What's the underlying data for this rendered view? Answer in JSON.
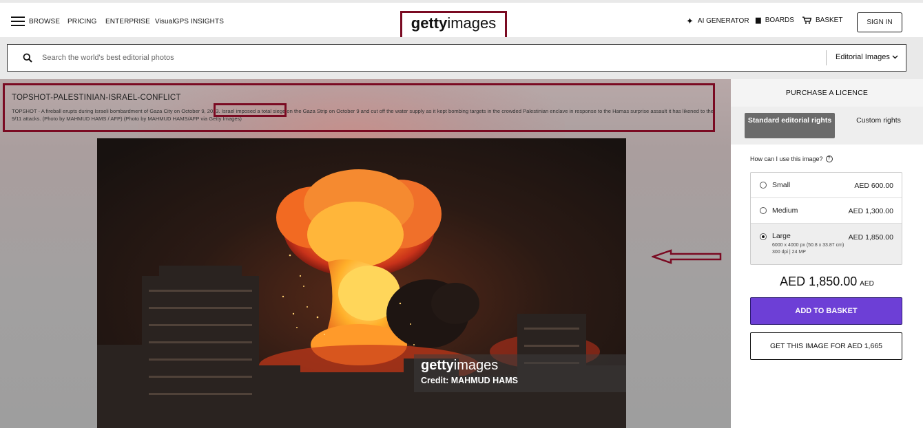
{
  "nav": {
    "browse": "BROWSE",
    "pricing": "PRICING",
    "enterprise": "ENTERPRISE",
    "insights": "VisualGPS INSIGHTS",
    "logo_bold": "getty",
    "logo_light": "images",
    "ai_generator": "AI GENERATOR",
    "boards": "BOARDS",
    "basket": "BASKET",
    "sign_in": "SIGN IN"
  },
  "search": {
    "placeholder": "Search the world's best editorial photos",
    "category": "Editorial Images"
  },
  "caption": {
    "title": "TOPSHOT-PALESTINIAN-ISRAEL-CONFLICT",
    "text": "TOPSHOT - A fireball erupts during Israeli bombardment of Gaza City on October 9, 2023. Israel imposed a total siege on the Gaza Strip on October 9 and cut off the water supply as it kept bombing targets in the crowded Palestinian enclave in response to the Hamas surprise assault it has likened to the 9/11 attacks. (Photo by MAHMUD HAMS / AFP) (Photo by MAHMUD HAMS/AFP via Getty Images)"
  },
  "watermark": {
    "logo_bold": "getty",
    "logo_light": "images",
    "credit": "Credit: MAHMUD HAMS"
  },
  "panel": {
    "title": "PURCHASE A LICENCE",
    "tab_standard": "Standard editorial rights",
    "tab_custom": "Custom rights",
    "question": "How can I use this image?",
    "sizes": [
      {
        "name": "Small",
        "price": "AED 600.00",
        "selected": false
      },
      {
        "name": "Medium",
        "price": "AED 1,300.00",
        "selected": false
      },
      {
        "name": "Large",
        "price": "AED 1,850.00",
        "selected": true,
        "detail1": "6000 x 4000 px (50.8 x 33.87 cm)",
        "detail2": "300 dpi | 24 MP"
      }
    ],
    "total_amount": "AED 1,850.00",
    "total_currency": "AED",
    "add_to_basket": "ADD TO BASKET",
    "get_image": "GET THIS IMAGE FOR AED 1,665"
  },
  "colors": {
    "accent_purple": "#6d3fd6",
    "annotation_red": "#7a0a22",
    "tab_selected": "#6b6b6b"
  }
}
